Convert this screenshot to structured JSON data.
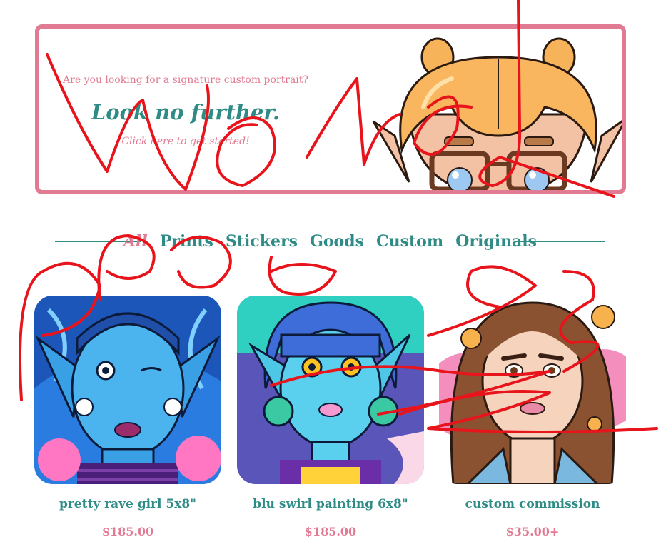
{
  "banner": {
    "question": "Are you looking for a signature custom portrait?",
    "title": "Look no further.",
    "cta": "Click here to get started!"
  },
  "nav": {
    "items": [
      "All",
      "Prints",
      "Stickers",
      "Goods",
      "Custom",
      "Originals"
    ],
    "active": "All"
  },
  "products": [
    {
      "name": "pretty rave girl 5x8\"",
      "price": "$185.00"
    },
    {
      "name": "blu swirl painting 6x8\"",
      "price": "$185.00"
    },
    {
      "name": "custom commission",
      "price": "$35.00+"
    }
  ],
  "colors": {
    "brand_pink": "#e17a93",
    "brand_teal": "#2e8b86",
    "scribble_red": "#e8141c"
  },
  "icons": [
    "banner-character-art",
    "product-artwork-image",
    "scribble-overlay"
  ]
}
